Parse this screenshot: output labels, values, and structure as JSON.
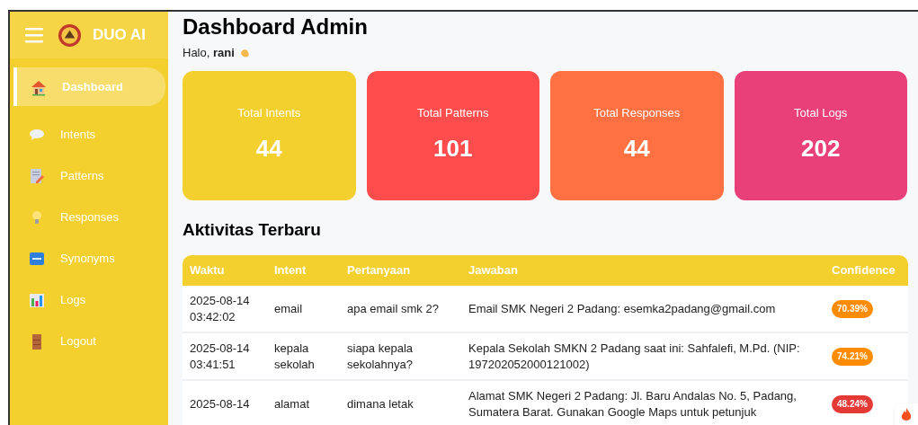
{
  "sidebar": {
    "brand": "DUO AI",
    "items": [
      {
        "label": "Dashboard",
        "selected": true
      },
      {
        "label": "Intents",
        "selected": false
      },
      {
        "label": "Patterns",
        "selected": false
      },
      {
        "label": "Responses",
        "selected": false
      },
      {
        "label": "Synonyms",
        "selected": false
      },
      {
        "label": "Logs",
        "selected": false
      },
      {
        "label": "Logout",
        "selected": false
      }
    ]
  },
  "header": {
    "title": "Dashboard Admin",
    "greeting": "Halo, **rani**"
  },
  "stats": [
    {
      "label": "Total Intents",
      "value": "44",
      "color": "#f4d02f"
    },
    {
      "label": "Total Patterns",
      "value": "101",
      "color": "#ff4d4d"
    },
    {
      "label": "Total Responses",
      "value": "44",
      "color": "#ff7043"
    },
    {
      "label": "Total Logs",
      "value": "202",
      "color": "#ea4079"
    }
  ],
  "activity": {
    "title": "Aktivitas Terbaru",
    "columns": [
      "Waktu",
      "Intent",
      "Pertanyaan",
      "Jawaban",
      "Confidence"
    ],
    "rows": [
      {
        "time": "2025-08-14 03:42:02",
        "intent": "email",
        "question": "apa email smk 2?",
        "answer": "Email SMK Negeri 2 Padang: esemka2padang@gmail.com",
        "confidence": "70.39%",
        "color": "#ff8c00"
      },
      {
        "time": "2025-08-14 03:41:51",
        "intent": "kepala sekolah",
        "question": "siapa kepala sekolahnya?",
        "answer": "Kepala Sekolah SMKN 2 Padang saat ini: Sahfalefi, M.Pd. (NIP: 197202052000121002)",
        "confidence": "74.21%",
        "color": "#ff8c00"
      },
      {
        "time": "2025-08-14",
        "intent": "alamat",
        "question": "dimana letak",
        "answer": "Alamat SMK Negeri 2 Padang: Jl. Baru Andalas No. 5, Padang, Sumatera Barat. Gunakan Google Maps untuk petunjuk",
        "confidence": "48.24%",
        "color": "#e53935"
      }
    ]
  }
}
